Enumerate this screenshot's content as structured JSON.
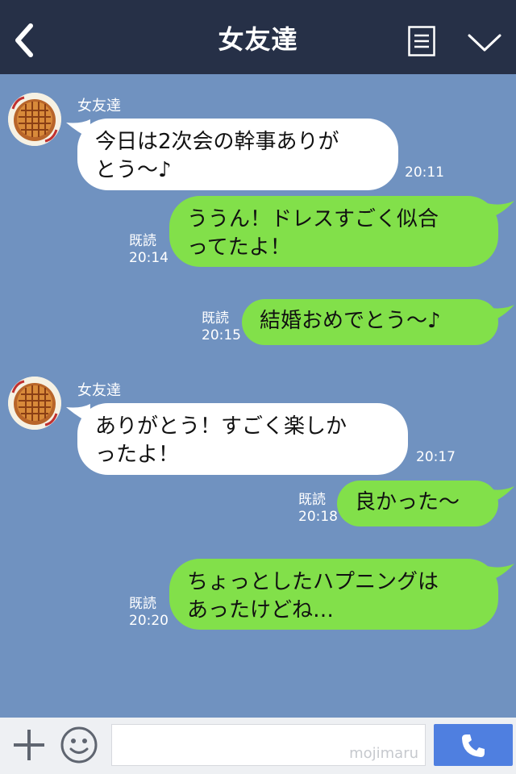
{
  "header": {
    "title": "女友達"
  },
  "messages": [
    {
      "sender": "女友達",
      "text1": "今日は2次会の幹事ありが",
      "text2": "とう〜♪",
      "time": "20:11"
    },
    {
      "read": "既読",
      "time": "20:14",
      "text1": "ううん！ドレスすごく似合",
      "text2": "ってたよ！"
    },
    {
      "read": "既読",
      "time": "20:15",
      "text1": "結婚おめでとう〜♪"
    },
    {
      "sender": "女友達",
      "text1": "ありがとう！すごく楽しか",
      "text2": "ったよ！",
      "time": "20:17"
    },
    {
      "read": "既読",
      "time": "20:18",
      "text1": "良かった〜"
    },
    {
      "read": "既読",
      "time": "20:20",
      "text1": "ちょっとしたハプニングは",
      "text2": "あったけどね…"
    }
  ],
  "footer": {
    "input_value": "",
    "watermark": "mojimaru"
  },
  "icons": {
    "back": "chevron-left-icon",
    "menu": "list-icon",
    "collapse": "chevron-down-icon",
    "add": "plus-icon",
    "emoji": "smiley-icon",
    "call": "phone-icon",
    "avatar": "pie-avatar"
  },
  "colors": {
    "header": "#263047",
    "background": "#7092c0",
    "incoming_bubble": "#ffffff",
    "outgoing_bubble": "#82e04a",
    "call_button": "#4f7fe0"
  }
}
